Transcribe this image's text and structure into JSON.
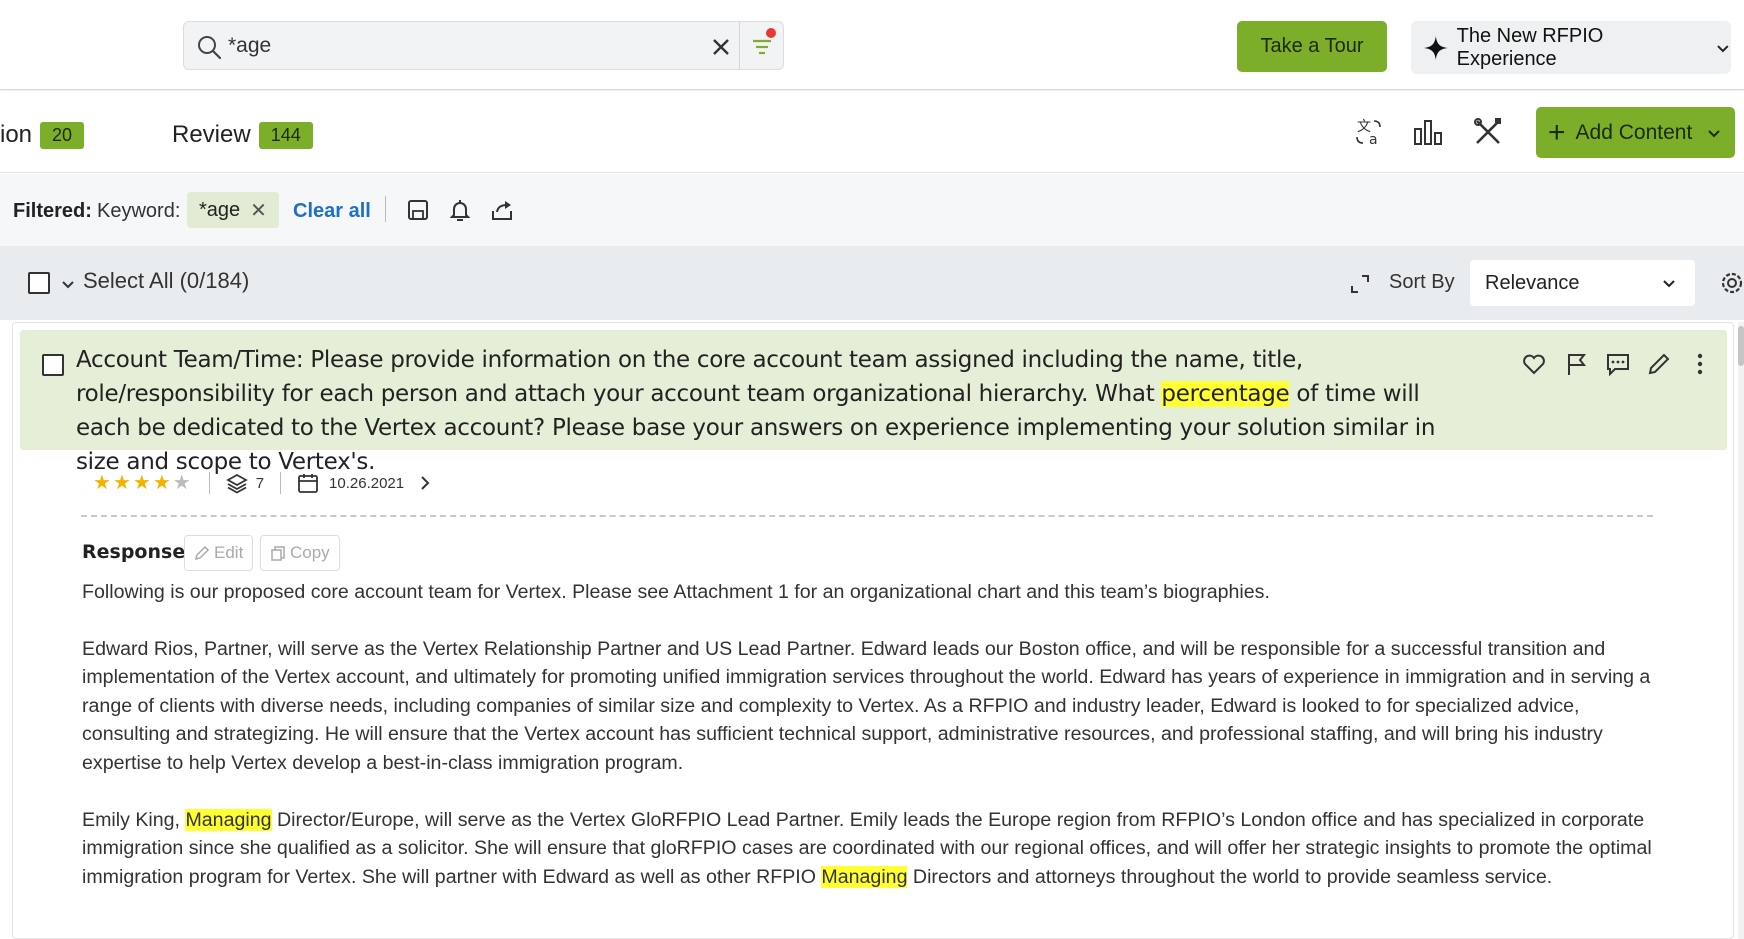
{
  "header": {
    "search_value": "*age",
    "tour_label": "Take a Tour",
    "rfpio_label": "The New RFPIO Experience"
  },
  "tabs": [
    {
      "label": "ion",
      "count": "20"
    },
    {
      "label": "Review",
      "count": "144"
    }
  ],
  "toolbar": {
    "add_content_label": "Add Content"
  },
  "filters": {
    "filtered_label": "Filtered:",
    "keyword_label": "Keyword:",
    "chip_value": "*age",
    "clear_all_label": "Clear all"
  },
  "selection": {
    "select_all_label": "Select All (0/184)",
    "sort_by_label": "Sort By",
    "sort_value": "Relevance"
  },
  "question": {
    "part1": "Account Team/Time:  Please provide information on the core account team assigned including the name, title, role/responsibility for each person and attach your account team organizational hierarchy. What ",
    "highlight": "percentage",
    "part2": " of time will each be dedicated to the Vertex account?  Please base your answers on experience implementing your solution similar in size and scope to Vertex's."
  },
  "meta": {
    "rating": 4,
    "rating_max": 5,
    "versions": "7",
    "date": "10.26.2021"
  },
  "response": {
    "label": "Response",
    "edit_label": "Edit",
    "copy_label": "Copy",
    "p1": "Following is our proposed core account team for Vertex. Please see Attachment 1 for an organizational chart and this team’s biographies.",
    "p2": "Edward Rios, Partner, will serve as the Vertex Relationship Partner and US Lead Partner. Edward leads our Boston office, and will be responsible for a successful transition and implementation of the Vertex account, and ultimately for promoting unified immigration services throughout the world. Edward has years of experience in immigration and in serving a range of clients with diverse needs, including companies of similar size and complexity to Vertex. As a RFPIO and industry leader, Edward is looked to for specialized advice, consulting and strategizing. He will ensure that the Vertex account has sufficient technical support, administrative resources, and professional staffing, and will bring his industry expertise to help Vertex develop a best-in-class immigration program.",
    "p3_a": "Emily King, ",
    "p3_hl1": "Managing",
    "p3_b": " Director/Europe, will serve as the Vertex GloRFPIO Lead Partner. Emily leads the Europe region from RFPIO’s London office and has specialized in corporate immigration since she qualified as a solicitor. She will ensure that gloRFPIO cases are coordinated with our regional offices, and will offer her strategic insights to promote the optimal immigration program for Vertex. She will partner with Edward as well as other RFPIO ",
    "p3_hl2": "Managing",
    "p3_c": " Directors and attorneys throughout the world to provide seamless service."
  },
  "colors": {
    "accent_green": "#7cae2a",
    "highlight_yellow": "#ffff33",
    "question_bg": "#e5efd7",
    "link_blue": "#1f6fc5",
    "star_gold": "#f5b301"
  }
}
